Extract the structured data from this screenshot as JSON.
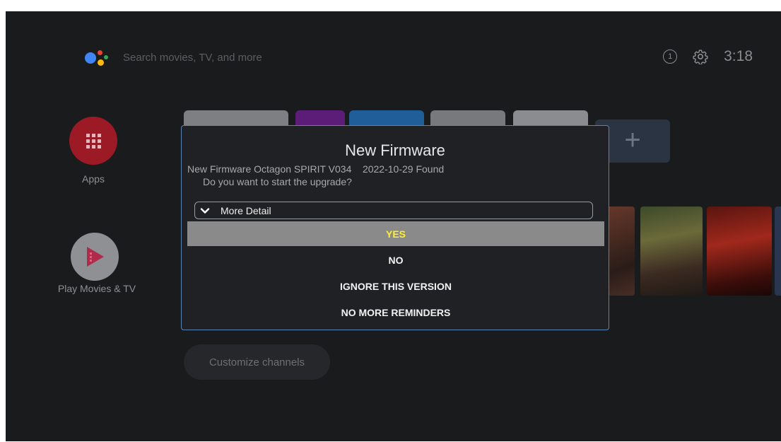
{
  "topbar": {
    "search_placeholder": "Search movies, TV, and more",
    "notification_count": "1",
    "clock": "3:18"
  },
  "rail": {
    "apps_label": "Apps",
    "play_label": "Play Movies & TV"
  },
  "app_row": {
    "add_symbol": "+"
  },
  "customize_label": "Customize channels",
  "dialog": {
    "title": "New Firmware",
    "message_line1": "New Firmware Octagon SPIRIT V034    2022-10-29 Found",
    "message_line2": "Do you want to start the upgrade?",
    "more_detail_label": "More Detail",
    "options": [
      "YES",
      "NO",
      "IGNORE THIS VERSION",
      "NO MORE REMINDERS"
    ],
    "selected_option": "YES"
  },
  "colors": {
    "background": "#1a1b1d",
    "dialog_bg": "#202124",
    "dialog_border": "#5a84b4",
    "selected_bg": "#8a8a8a",
    "selected_text": "#ffee33",
    "apps_red": "#9b1a25"
  }
}
